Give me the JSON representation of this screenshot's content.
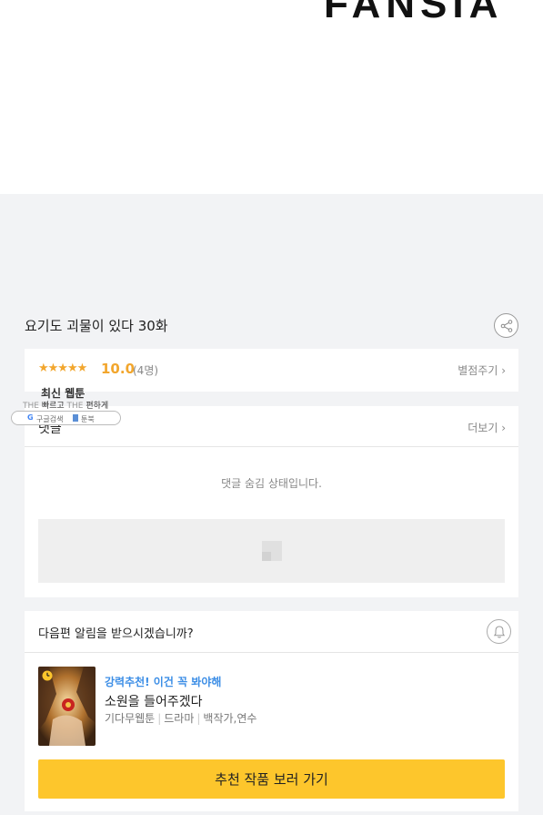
{
  "header": {
    "logo_text": "FANSIA"
  },
  "episode": {
    "title": "요기도 괴물이 있다 30화"
  },
  "rating": {
    "stars": "★★★★★",
    "score": "10.0",
    "count": "(4명)",
    "rate_label": "별점주기 ›"
  },
  "ad": {
    "headline": "최신 웹툰",
    "line_1a": "THE",
    "line_1b": "빠르고",
    "line_1c": "THE",
    "line_1d": "편하게",
    "pill_1": "구글검색",
    "pill_2": "툰북"
  },
  "comments": {
    "title": "댓글",
    "more_label": "더보기 ›",
    "hidden_message": "댓글 숨김 상태입니다."
  },
  "notify": {
    "question": "다음편 알림을 받으시겠습니까?",
    "tag": "강력추천! 이건 꼭 봐야해",
    "title": "소원을 들어주겠다",
    "meta_1": "기다무웹툰",
    "meta_2": "드라마",
    "meta_3": "백작가,연수",
    "button_label": "추천 작품 보러 가기"
  },
  "colors": {
    "accent": "#fdc62c",
    "star": "#f2a62d",
    "link_blue": "#3c8ee6"
  },
  "icons": [
    "share-icon",
    "bell-icon",
    "clock-icon",
    "comment-placeholder-icon"
  ]
}
